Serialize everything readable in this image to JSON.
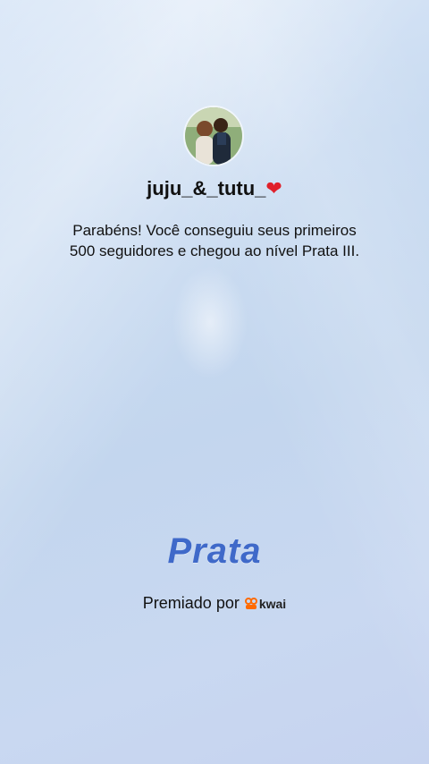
{
  "profile": {
    "username": "juju_&_tutu_",
    "heart_icon": "❤"
  },
  "message": {
    "line1": "Parabéns! Você conseguiu seus primeiros",
    "line2": "500 seguidores e chegou ao nível Prata III."
  },
  "level": {
    "name": "Prata"
  },
  "awarded": {
    "label": "Premiado por",
    "brand": "kwai",
    "brand_color": "#ff6a00"
  }
}
